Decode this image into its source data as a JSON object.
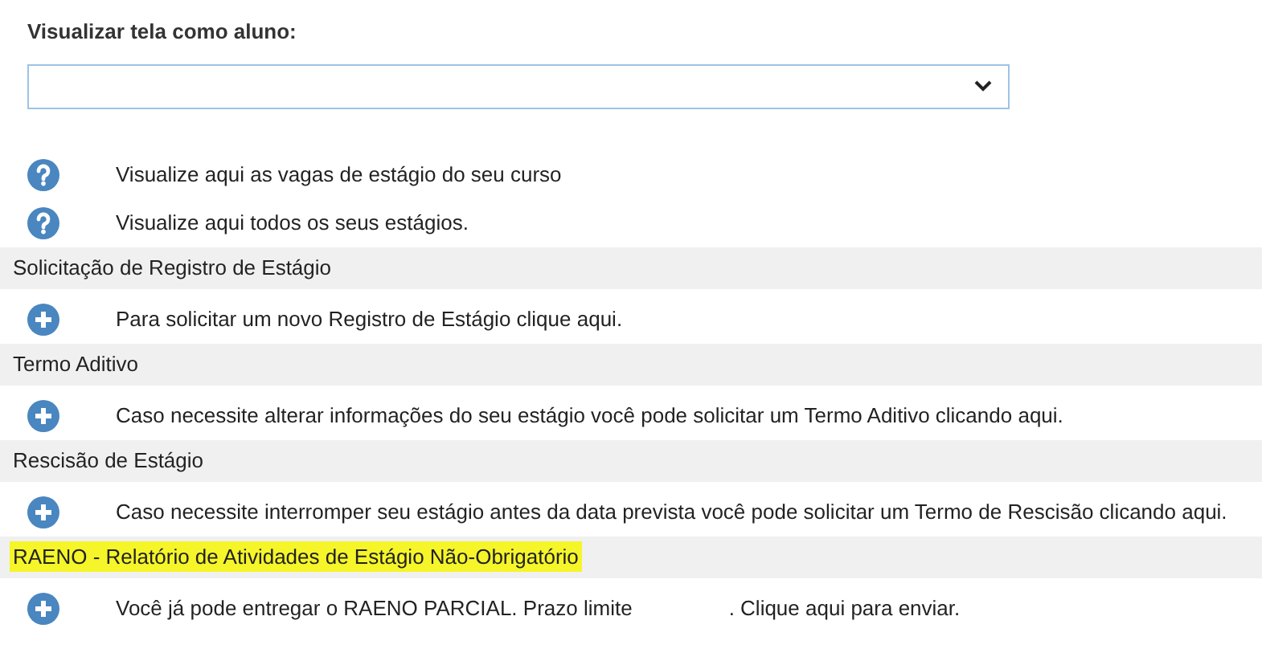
{
  "student_view": {
    "label": "Visualizar tela como aluno:"
  },
  "rows": [
    {
      "kind": "help",
      "text": "Visualize aqui as vagas de estágio do seu curso"
    },
    {
      "kind": "help",
      "text": "Visualize aqui todos os seus estágios."
    },
    {
      "kind": "section",
      "text": "Solicitação de Registro de Estágio",
      "highlighted": false
    },
    {
      "kind": "add",
      "text": "Para solicitar um novo Registro de Estágio clique aqui."
    },
    {
      "kind": "section",
      "text": "Termo Aditivo",
      "highlighted": false
    },
    {
      "kind": "add",
      "text": "Caso necessite alterar informações do seu estágio você pode solicitar um Termo Aditivo clicando aqui."
    },
    {
      "kind": "section",
      "text": "Rescisão de Estágio",
      "highlighted": false
    },
    {
      "kind": "add",
      "text": "Caso necessite interromper seu estágio antes da data prevista você pode solicitar um Termo de Rescisão clicando aqui."
    },
    {
      "kind": "section",
      "text": "RAENO - Relatório de Atividades de Estágio Não-Obrigatório",
      "highlighted": true
    },
    {
      "kind": "add",
      "text": "Você já pode entregar o RAENO PARCIAL. Prazo limite",
      "text_after": ". Clique aqui para enviar."
    }
  ]
}
